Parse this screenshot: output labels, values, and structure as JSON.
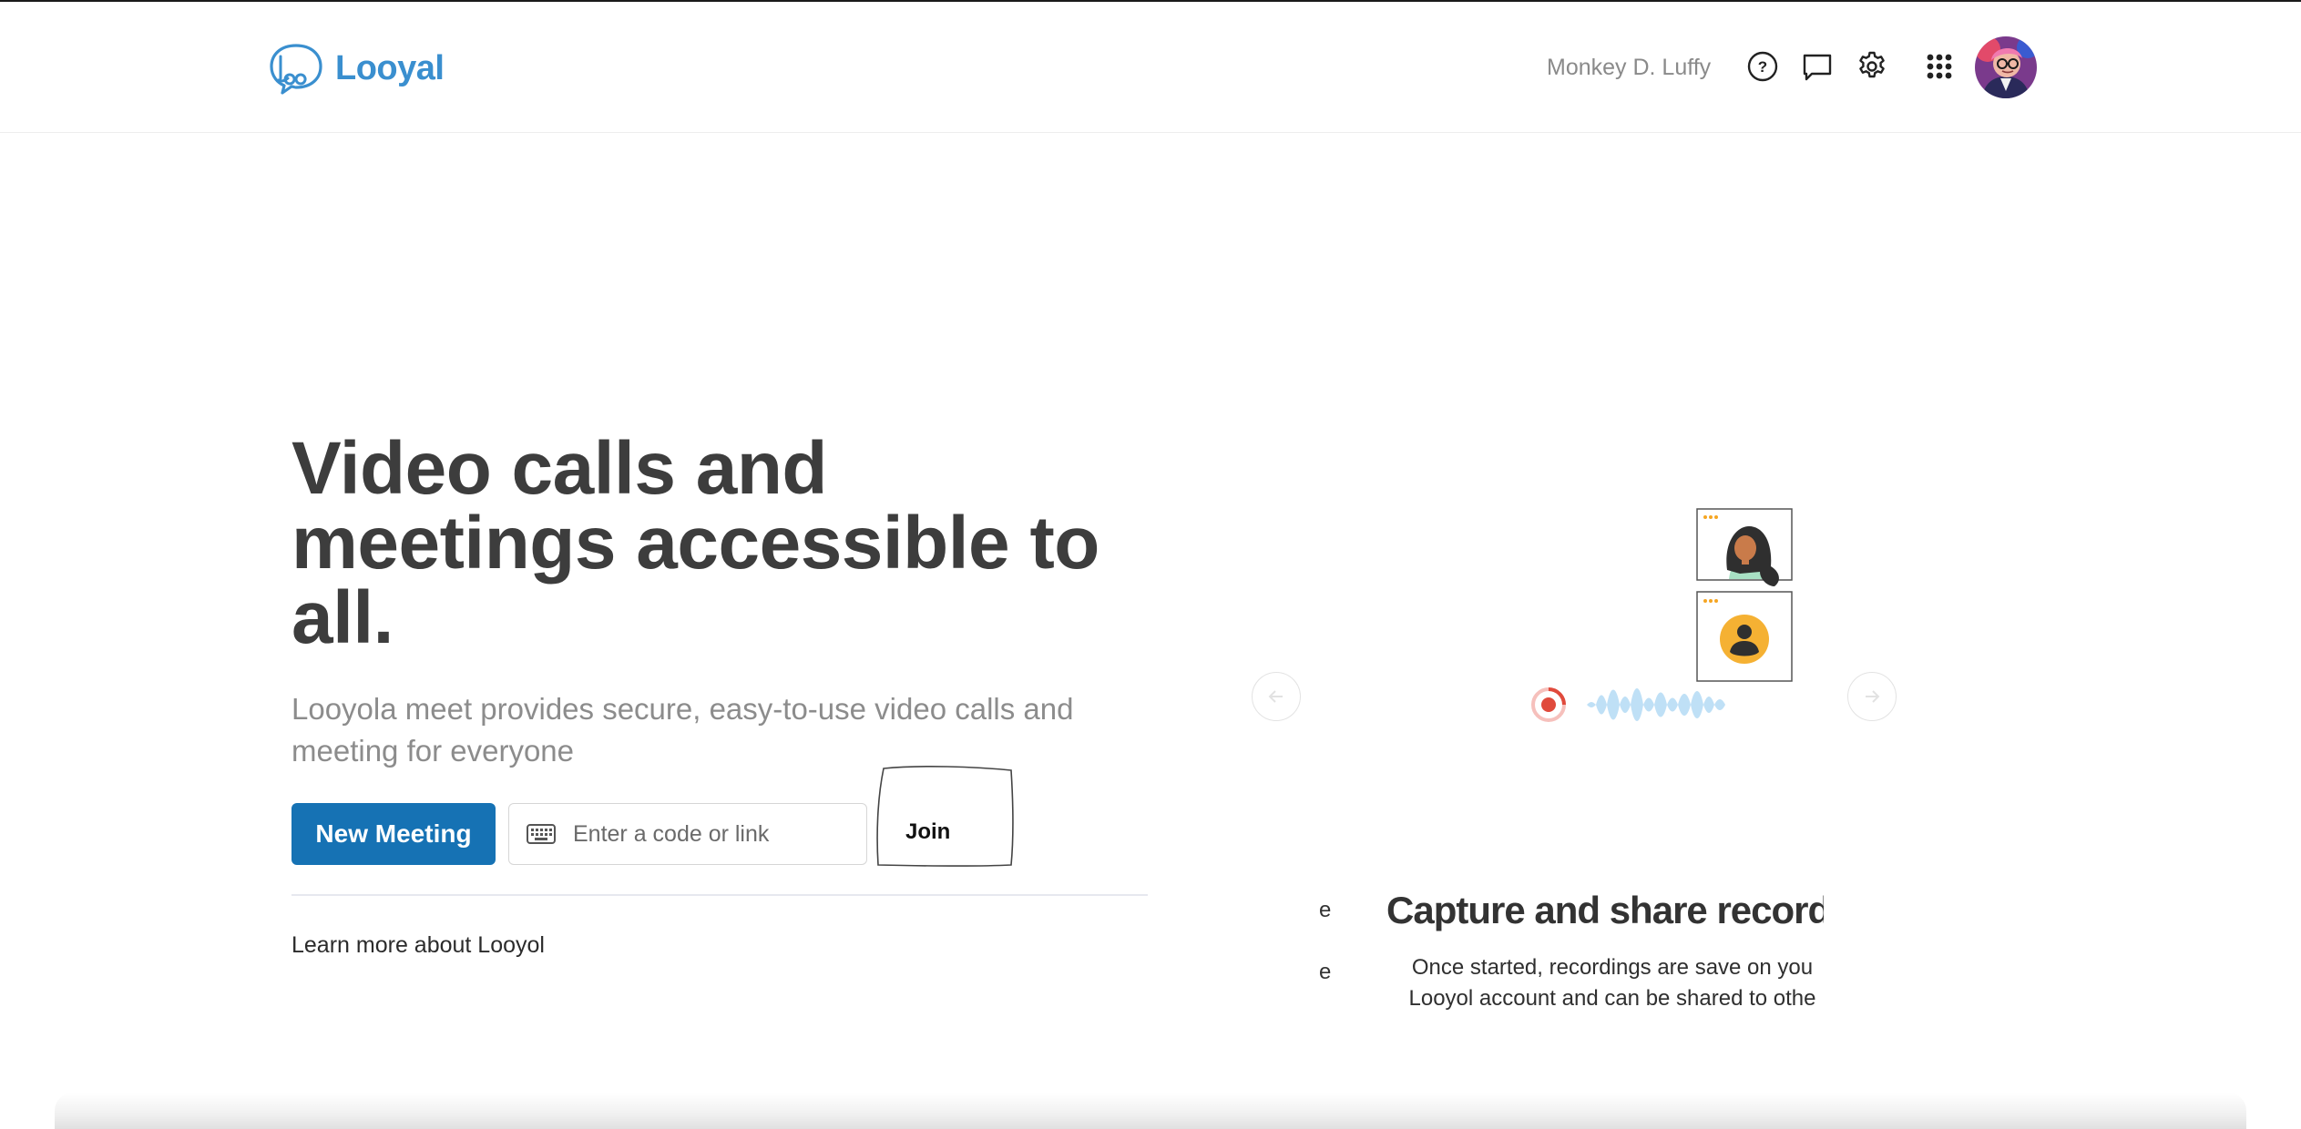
{
  "app": {
    "logo_text": "Looyal"
  },
  "header": {
    "user_name": "Monkey D. Luffy",
    "icons": {
      "help": "help-icon",
      "feedback": "chat-bubble-icon",
      "settings": "gear-icon",
      "apps": "grid-apps-icon"
    }
  },
  "hero": {
    "title_line1": "Video calls and",
    "title_line2": "meetings accessible to",
    "title_line3": "all.",
    "subtitle": "Looyola meet provides secure, easy-to-use video calls and meeting for everyone"
  },
  "actions": {
    "new_meeting_label": "New Meeting",
    "code_placeholder": "Enter a code or link",
    "join_label": "Join",
    "learn_more": "Learn more about Looyol"
  },
  "slide": {
    "prev_fragment_1": "e",
    "prev_fragment_2": "e",
    "title": "Capture and share recordin",
    "desc_line1": "Once started, recordings are save on you",
    "desc_line2": "Looyol account and can be shared to othe"
  },
  "colors": {
    "brand": "#3a8fcf",
    "primary_button": "#1672b4",
    "text_dark": "#3d3d3d",
    "text_muted": "#8c8c8c"
  }
}
